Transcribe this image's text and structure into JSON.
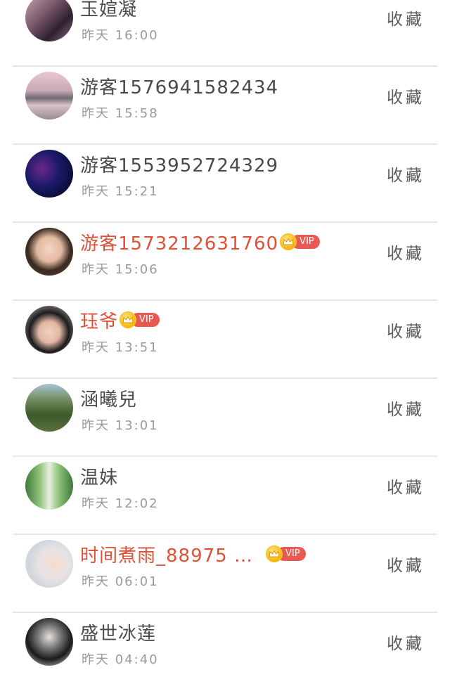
{
  "favorite_label": "收藏",
  "vip_label": "VIP",
  "colors": {
    "vip_name": "#e0513a",
    "normal_name": "#4a4a4a",
    "time": "#9a9a9a",
    "vip_pill": "#e85a51",
    "crown": "#f4b400"
  },
  "items": [
    {
      "name": "玉媗凝",
      "time": "昨天 16:00",
      "vip": false
    },
    {
      "name": "游客1576941582434",
      "time": "昨天 15:58",
      "vip": false
    },
    {
      "name": "游客1553952724329",
      "time": "昨天 15:21",
      "vip": false
    },
    {
      "name": "游客1573212631760",
      "time": "昨天 15:06",
      "vip": true
    },
    {
      "name": "珏爷",
      "time": "昨天 13:51",
      "vip": true
    },
    {
      "name": "涵曦兒",
      "time": "昨天 13:01",
      "vip": false
    },
    {
      "name": "温妹",
      "time": "昨天 12:02",
      "vip": false
    },
    {
      "name": "时间煮雨_88975 …",
      "time": "昨天 06:01",
      "vip": true
    },
    {
      "name": "盛世冰莲",
      "time": "昨天 04:40",
      "vip": false
    }
  ]
}
